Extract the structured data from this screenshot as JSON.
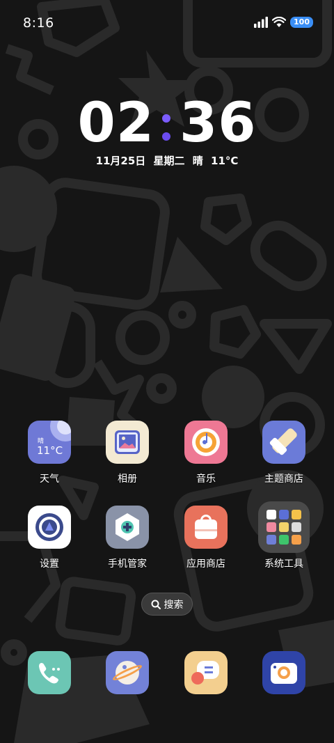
{
  "status_bar": {
    "time": "8:16",
    "battery": "100",
    "icons": [
      "signal-icon",
      "wifi-icon",
      "battery-icon"
    ]
  },
  "clock": {
    "hours": "02",
    "minutes": "36",
    "colon_colors": [
      "#7b5cff",
      "#7b5cff"
    ],
    "date": "11月25日",
    "weekday": "星期二",
    "weather": "晴",
    "temperature": "11°C"
  },
  "apps": [
    {
      "label": "天气",
      "icon": "weather-icon",
      "widget_condition": "晴",
      "widget_temp": "11°C"
    },
    {
      "label": "相册",
      "icon": "gallery-icon"
    },
    {
      "label": "音乐",
      "icon": "music-icon"
    },
    {
      "label": "主题商店",
      "icon": "theme-store-icon"
    },
    {
      "label": "设置",
      "icon": "settings-icon"
    },
    {
      "label": "手机管家",
      "icon": "phone-manager-icon"
    },
    {
      "label": "应用商店",
      "icon": "app-store-icon"
    },
    {
      "label": "系统工具",
      "icon": "system-tools-folder-icon"
    }
  ],
  "search": {
    "label": "搜索",
    "icon": "search-icon"
  },
  "dock": [
    {
      "icon": "phone-icon"
    },
    {
      "icon": "browser-icon"
    },
    {
      "icon": "messages-icon"
    },
    {
      "icon": "camera-icon"
    }
  ]
}
